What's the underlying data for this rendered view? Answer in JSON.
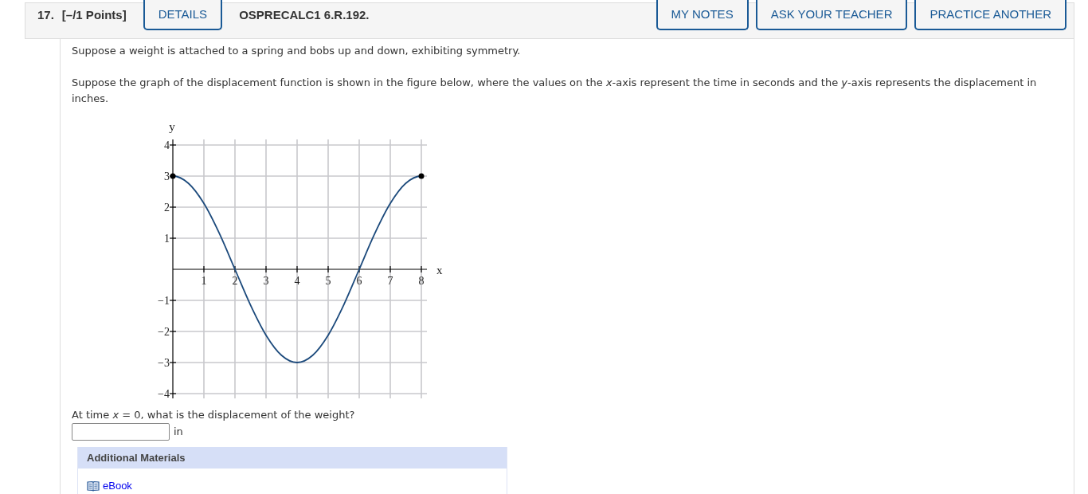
{
  "question": {
    "number": "17.",
    "points": "[–/1 Points]",
    "details_button": "DETAILS",
    "code": "OSPRECALC1 6.R.192.",
    "action_buttons": [
      "MY NOTES",
      "ASK YOUR TEACHER",
      "PRACTICE ANOTHER"
    ]
  },
  "paragraphs": [
    "Suppose a weight is attached to a spring and bobs up and down, exhibiting symmetry.",
    "Suppose the graph of the displacement function is shown in the figure below, where the values on the *x*-axis represent the time in seconds and the *y*-axis represents the displacement in inches."
  ],
  "figure": {
    "chart_data": {
      "type": "line",
      "xlabel": "x",
      "ylabel": "y",
      "x": [
        0,
        0.5,
        1,
        1.5,
        2,
        2.5,
        3,
        3.5,
        4,
        4.5,
        5,
        5.5,
        6,
        6.5,
        7,
        7.5,
        8
      ],
      "series": [
        {
          "color": "#1c4a7c",
          "values": [
            3,
            2.77,
            2.12,
            1.15,
            0,
            -1.15,
            -2.12,
            -2.77,
            -3,
            -2.77,
            -2.12,
            -1.15,
            0,
            1.15,
            2.12,
            2.77,
            3
          ]
        }
      ],
      "xlim": [
        0,
        8
      ],
      "ylim": [
        -4,
        4
      ],
      "xticks": [
        1,
        2,
        3,
        4,
        5,
        6,
        7,
        8
      ],
      "yticks": [
        {
          "value": -4,
          "label": "−4"
        },
        {
          "value": -3,
          "label": "−3"
        },
        {
          "value": -2,
          "label": "−2"
        },
        {
          "value": -1,
          "label": "−1"
        },
        1,
        2,
        3,
        4
      ],
      "grid": true
    }
  },
  "prompt": "At time *x* = 0, what is the displacement of the weight?",
  "answer": {
    "unit": "in"
  },
  "additional_materials": {
    "title": "Additional Materials",
    "links": [
      {
        "label": "eBook"
      }
    ]
  }
}
